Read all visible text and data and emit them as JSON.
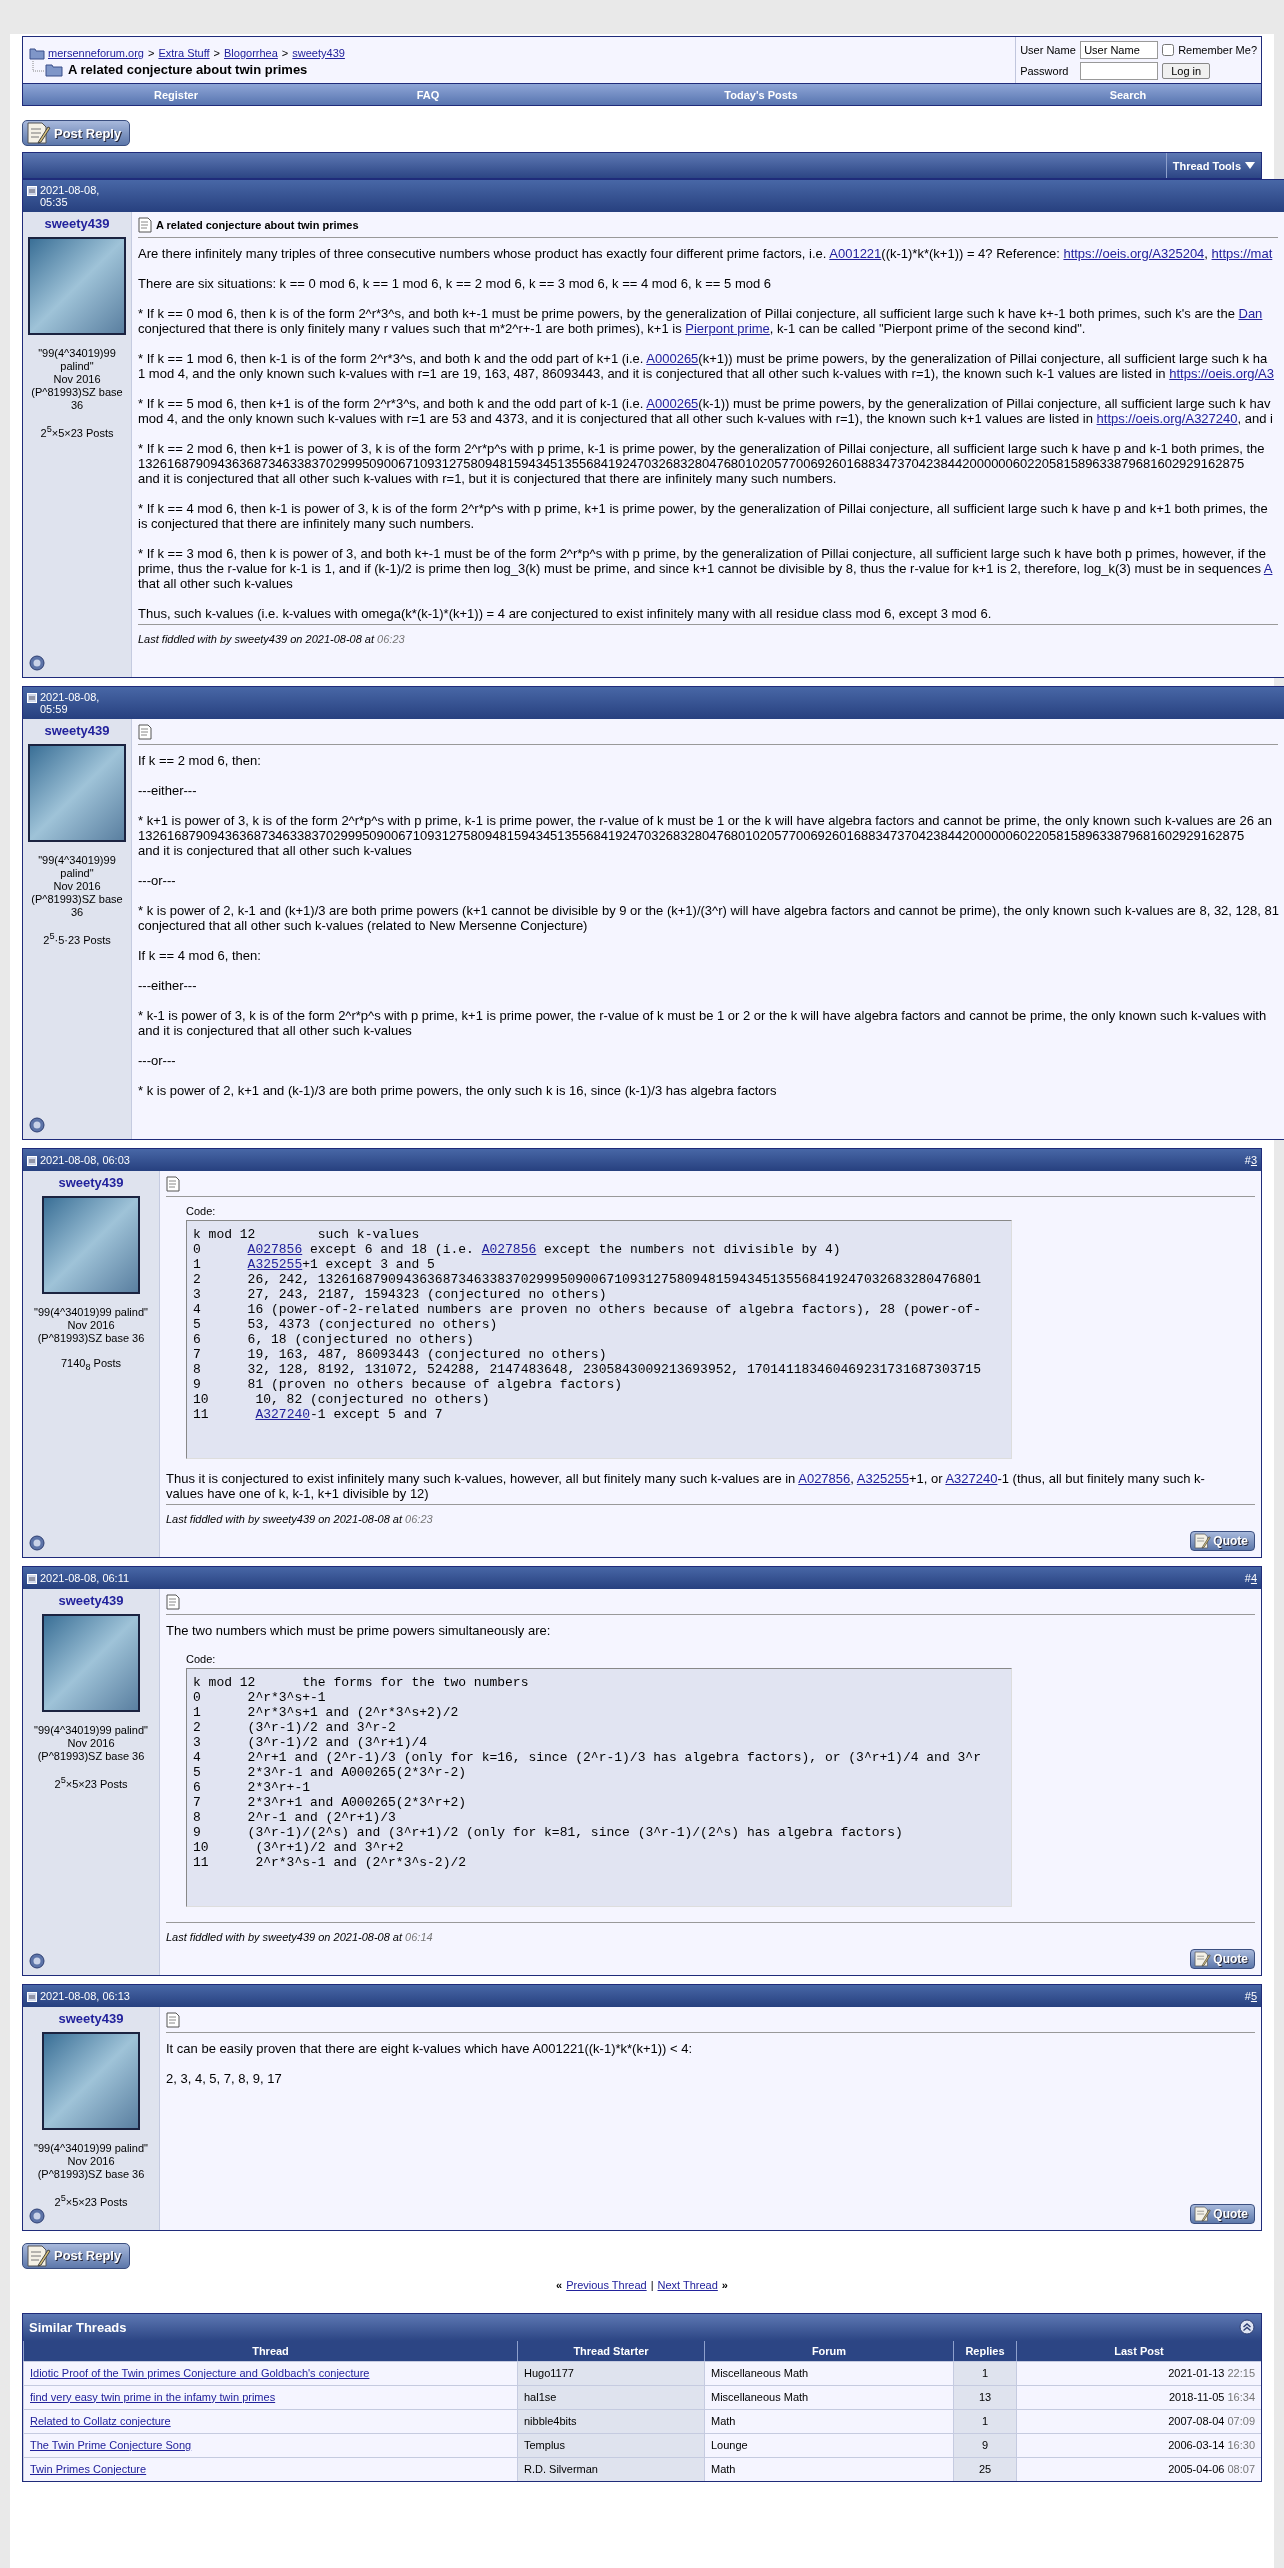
{
  "header": {
    "breadcrumb": [
      "mersenneforum.org",
      "Extra Stuff",
      "Blogorrhea",
      "sweety439"
    ],
    "separator": ">",
    "thread_title": "A related conjecture about twin primes",
    "login": {
      "user_name_label": "User Name",
      "user_name_value": "User Name",
      "remember_label": "Remember Me?",
      "remember_checked": false,
      "password_label": "Password",
      "login_button": "Log in"
    }
  },
  "navbar": [
    "Register",
    "FAQ",
    "Today's Posts",
    "Search"
  ],
  "post_reply_button": "Post Reply",
  "thread_tools": "Thread Tools",
  "posts": [
    {
      "date": "2021-08-08, 05:35",
      "author": "sweety439",
      "user_title": [
        "\"99(4^34019)99 palind\"",
        "Nov 2016",
        "(P^81993)SZ base 36"
      ],
      "posts_count": "2$^{5}$×5×23 Posts",
      "title": "A related conjecture about twin primes",
      "body": [
        {
          "kind": "text",
          "lines": [
            [
              "Are there infinitely many triples of three consecutive numbers whose product has exactly four different prime factors, i.e. ",
              {
                "link": "A001221"
              },
              "((k-1)*k*(k+1)) = 4? Reference: ",
              {
                "link": "https://oeis.org/A325204"
              },
              ", ",
              {
                "link": "https://mat"
              }
            ]
          ]
        },
        {
          "kind": "text",
          "lines": [
            [
              "There are six situations: k == 0 mod 6, k == 1 mod 6, k == 2 mod 6, k == 3 mod 6, k == 4 mod 6, k == 5 mod 6"
            ]
          ]
        },
        {
          "kind": "text",
          "lines": [
            [
              "* If k == 0 mod 6, then k is of the form 2^r*3^s, and both k+-1 must be prime powers, by the generalization of Pillai conjecture, all sufficient large such k have k+-1 both primes, such k's are the ",
              {
                "link": "Dan"
              }
            ],
            [
              "conjectured that there is only finitely many r values such that m*2^r+-1 are both primes), k+1 is ",
              {
                "link": "Pierpont prime"
              },
              ", k-1 can be called \"Pierpont prime of the second kind\"."
            ]
          ]
        },
        {
          "kind": "text",
          "lines": [
            [
              "* If k == 1 mod 6, then k-1 is of the form 2^r*3^s, and both k and the odd part of k+1 (i.e. ",
              {
                "link": "A000265"
              },
              "(k+1)) must be prime powers, by the generalization of Pillai conjecture, all sufficient large such k ha"
            ],
            [
              "1 mod 4, and the only known such k-values with r=1 are 19, 163, 487, 86093443, and it is conjectured that all other such k-values with r=1), the known such k-1 values are listed in ",
              {
                "link": "https://oeis.org/A3"
              }
            ]
          ]
        },
        {
          "kind": "text",
          "lines": [
            [
              "* If k == 5 mod 6, then k+1 is of the form 2^r*3^s, and both k and the odd part of k-1 (i.e. ",
              {
                "link": "A000265"
              },
              "(k-1)) must be prime powers, by the generalization of Pillai conjecture, all sufficient large such k hav"
            ],
            [
              "mod 4, and the only known such k-values with r=1 are 53 and 4373, and it is conjectured that all other such k-values with r=1), the known such k+1 values are listed in ",
              {
                "link": "https://oeis.org/A327240"
              },
              ", and i"
            ]
          ]
        },
        {
          "kind": "text",
          "lines": [
            [
              "* If k == 2 mod 6, then k+1 is power of 3, k is of the form 2^r*p^s with p prime, k-1 is prime power, by the generalization of Pillai conjecture, all sufficient large such k have p and k-1 both primes, the"
            ],
            [
              "132616879094363687346338370299950900671093127580948159434513556841924703268328047680102057700692601688347370423844200000060220581589633879681602929162875"
            ],
            [
              "and it is conjectured that all other such k-values with r=1, but it is conjectured that there are infinitely many such numbers."
            ]
          ]
        },
        {
          "kind": "text",
          "lines": [
            [
              "* If k == 4 mod 6, then k-1 is power of 3, k is of the form 2^r*p^s with p prime, k+1 is prime power, by the generalization of Pillai conjecture, all sufficient large such k have p and k+1 both primes, the"
            ],
            [
              "is conjectured that there are infinitely many such numbers."
            ]
          ]
        },
        {
          "kind": "text",
          "lines": [
            [
              "* If k == 3 mod 6, then k is power of 3, and both k+-1 must be of the form 2^r*p^s with p prime, by the generalization of Pillai conjecture, all sufficient large such k have both p primes, however, if the"
            ],
            [
              "prime, thus the r-value for k-1 is 1, and if (k-1)/2 is prime then log_3(k) must be prime, and since k+1 cannot be divisible by 8, thus the r-value for k+1 is 2, therefore, log_k(3) must be in sequences ",
              {
                "link": "A"
              }
            ],
            [
              "that all other such k-values"
            ]
          ]
        },
        {
          "kind": "text",
          "lines": [
            [
              "Thus, such k-values (i.e. k-values with omega(k*(k-1)*(k+1)) = 4 are conjectured to exist infinitely many with all residue class mod 6, except 3 mod 6."
            ]
          ]
        }
      ],
      "edited": {
        "text": "Last fiddled with by sweety439 on 2021-08-08 at",
        "time": "06:23"
      }
    },
    {
      "date": "2021-08-08, 05:59",
      "author": "sweety439",
      "user_title": [
        "\"99(4^34019)99 palind\"",
        "Nov 2016",
        "(P^81993)SZ base 36"
      ],
      "posts_count": "2$^{5}$·5·23 Posts",
      "body": [
        {
          "kind": "text",
          "lines": [
            [
              "If k == 2 mod 6, then:"
            ]
          ]
        },
        {
          "kind": "text",
          "lines": [
            [
              "---either---"
            ]
          ]
        },
        {
          "kind": "text",
          "lines": [
            [
              "* k+1 is power of 3, k is of the form 2^r*p^s with p prime, k-1 is prime power, the r-value of k must be 1 or the k will have algebra factors and cannot be prime, the only known such k-values are 26 an"
            ],
            [
              "132616879094363687346338370299950900671093127580948159434513556841924703268328047680102057700692601688347370423844200000060220581589633879681602929162875"
            ],
            [
              "and it is conjectured that all other such k-values"
            ]
          ]
        },
        {
          "kind": "text",
          "lines": [
            [
              "---or---"
            ]
          ]
        },
        {
          "kind": "text",
          "lines": [
            [
              "* k is power of 2, k-1 and (k+1)/3 are both prime powers (k+1 cannot be divisible by 9 or the (k+1)/(3^r) will have algebra factors and cannot be prime), the only known such k-values are 8, 32, 128, 81"
            ],
            [
              "conjectured that all other such k-values (related to New Mersenne Conjecture)"
            ]
          ]
        },
        {
          "kind": "text",
          "lines": [
            [
              "If k == 4 mod 6, then:"
            ]
          ]
        },
        {
          "kind": "text",
          "lines": [
            [
              "---either---"
            ]
          ]
        },
        {
          "kind": "text",
          "lines": [
            [
              "* k-1 is power of 3, k is of the form 2^r*p^s with p prime, k+1 is prime power, the r-value of k must be 1 or 2 or the k will have algebra factors and cannot be prime, the only known such k-values with"
            ],
            [
              "and it is conjectured that all other such k-values"
            ]
          ]
        },
        {
          "kind": "text",
          "lines": [
            [
              "---or---"
            ]
          ]
        },
        {
          "kind": "text",
          "lines": [
            [
              "* k is power of 2, k+1 and (k-1)/3 are both prime powers, the only such k is 16, since (k-1)/3 has algebra factors"
            ]
          ]
        }
      ]
    },
    {
      "date": "2021-08-08, 06:03",
      "number_prefix": "#",
      "number": "3",
      "author": "sweety439",
      "user_title": [
        "\"99(4^34019)99 palind\"",
        "Nov 2016",
        "(P^81993)SZ base 36"
      ],
      "posts_count": "7140$_{8}$ Posts",
      "body": [
        {
          "kind": "code",
          "label": "Code:",
          "rows": [
            [
              "k mod 12        such k-values"
            ],
            [
              "0      ",
              {
                "link": "A027856"
              },
              " except 6 and 18 (i.e. ",
              {
                "link": "A027856"
              },
              " except the numbers not divisible by 4)"
            ],
            [
              "1      ",
              {
                "link": "A325255"
              },
              "+1 except 3 and 5"
            ],
            [
              "2      26, 242, 1326168790943636873463383702999509006710931275809481594345135568419247032683280476801"
            ],
            [
              "3      27, 243, 2187, 1594323 (conjectured no others)"
            ],
            [
              "4      16 (power-of-2-related numbers are proven no others because of algebra factors), 28 (power-of-"
            ],
            [
              "5      53, 4373 (conjectured no others)"
            ],
            [
              "6      6, 18 (conjectured no others)"
            ],
            [
              "7      19, 163, 487, 86093443 (conjectured no others)"
            ],
            [
              "8      32, 128, 8192, 131072, 524288, 2147483648, 2305843009213693952, 170141183460469231731687303715"
            ],
            [
              "9      81 (proven no others because of algebra factors)"
            ],
            [
              "10      10, 82 (conjectured no others)"
            ],
            [
              "11      ",
              {
                "link": "A327240"
              },
              "-1 except 5 and 7"
            ]
          ]
        },
        {
          "kind": "text",
          "lines": [
            [
              "Thus it is conjectured to exist infinitely many such k-values, however, all but finitely many such k-values are in ",
              {
                "link": "A027856"
              },
              ", ",
              {
                "link": "A325255"
              },
              "+1, or ",
              {
                "link": "A327240"
              },
              "-1 (thus, all but finitely many such k-"
            ],
            [
              "values have one of k, k-1, k+1 divisible by 12)"
            ]
          ]
        }
      ],
      "edited": {
        "text": "Last fiddled with by sweety439 on 2021-08-08 at",
        "time": "06:23"
      },
      "quote_button": "Quote"
    },
    {
      "date": "2021-08-08, 06:11",
      "number_prefix": "#",
      "number": "4",
      "author": "sweety439",
      "user_title": [
        "\"99(4^34019)99 palind\"",
        "Nov 2016",
        "(P^81993)SZ base 36"
      ],
      "posts_count": "2$^{5}$×5×23 Posts",
      "body": [
        {
          "kind": "text",
          "lines": [
            [
              "The two numbers which must be prime powers simultaneously are:"
            ]
          ]
        },
        {
          "kind": "code",
          "label": "Code:",
          "rows": [
            [
              "k mod 12      the forms for the two numbers"
            ],
            [
              "0      2^r*3^s+-1"
            ],
            [
              "1      2^r*3^s+1 and (2^r*3^s+2)/2"
            ],
            [
              "2      (3^r-1)/2 and 3^r-2"
            ],
            [
              "3      (3^r-1)/2 and (3^r+1)/4"
            ],
            [
              "4      2^r+1 and (2^r-1)/3 (only for k=16, since (2^r-1)/3 has algebra factors), or (3^r+1)/4 and 3^r"
            ],
            [
              "5      2*3^r-1 and A000265(2*3^r-2)"
            ],
            [
              "6      2*3^r+-1"
            ],
            [
              "7      2*3^r+1 and A000265(2*3^r+2)"
            ],
            [
              "8      2^r-1 and (2^r+1)/3"
            ],
            [
              "9      (3^r-1)/(2^s) and (3^r+1)/2 (only for k=81, since (3^r-1)/(2^s) has algebra factors)"
            ],
            [
              "10      (3^r+1)/2 and 3^r+2"
            ],
            [
              "11      2^r*3^s-1 and (2^r*3^s-2)/2"
            ]
          ]
        }
      ],
      "edited": {
        "text": "Last fiddled with by sweety439 on 2021-08-08 at",
        "time": "06:14"
      },
      "quote_button": "Quote"
    },
    {
      "date": "2021-08-08, 06:13",
      "number_prefix": "#",
      "number": "5",
      "author": "sweety439",
      "user_title": [
        "\"99(4^34019)99 palind\"",
        "Nov 2016",
        "(P^81993)SZ base 36"
      ],
      "posts_count": "2$^{5}$×5×23 Posts",
      "body": [
        {
          "kind": "text",
          "lines": [
            [
              "It can be easily proven that there are eight k-values which have A001221((k-1)*k*(k+1)) < 4:"
            ]
          ]
        },
        {
          "kind": "text",
          "lines": [
            [
              "2, 3, 4, 5, 7, 8, 9, 17"
            ]
          ]
        }
      ],
      "quote_button": "Quote"
    }
  ],
  "bottom_post_reply_button": "Post Reply",
  "thread_nav": {
    "open": "«",
    "previous": "Previous Thread",
    "divider": "|",
    "next": "Next Thread",
    "close": "»"
  },
  "similar_threads": {
    "title": "Similar Threads",
    "columns": [
      "Thread",
      "Thread Starter",
      "Forum",
      "Replies",
      "Last Post"
    ],
    "rows": [
      {
        "thread": "Idiotic Proof of the Twin primes Conjecture and Goldbach's conjecture",
        "starter": "Hugo1177",
        "forum": "Miscellaneous Math",
        "replies": "1",
        "date": "2021-01-13",
        "time": "22:15"
      },
      {
        "thread": "find very easy twin prime in the infamy twin primes",
        "starter": "hal1se",
        "forum": "Miscellaneous Math",
        "replies": "13",
        "date": "2018-11-05",
        "time": "16:34"
      },
      {
        "thread": "Related to Collatz conjecture",
        "starter": "nibble4bits",
        "forum": "Math",
        "replies": "1",
        "date": "2007-08-04",
        "time": "07:09"
      },
      {
        "thread": "The Twin Prime Conjecture Song",
        "starter": "Templus",
        "forum": "Lounge",
        "replies": "9",
        "date": "2006-03-14",
        "time": "16:30"
      },
      {
        "thread": "Twin Primes Conjecture",
        "starter": "R.D. Silverman",
        "forum": "Math",
        "replies": "25",
        "date": "2005-04-06",
        "time": "08:07"
      }
    ]
  }
}
